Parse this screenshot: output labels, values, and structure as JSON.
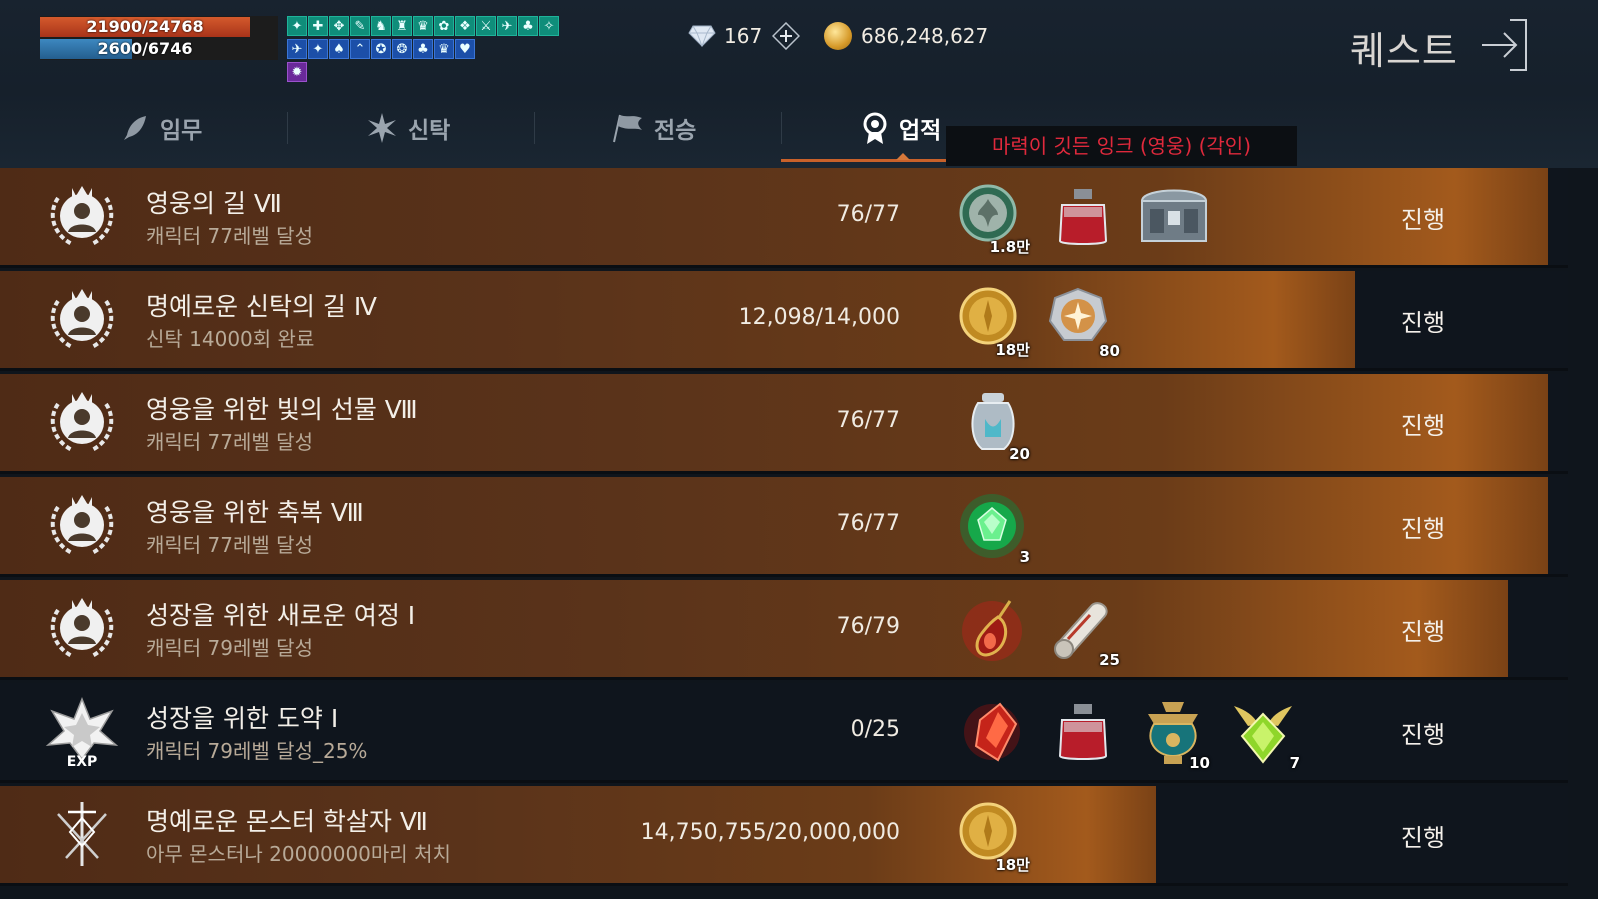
{
  "player": {
    "hp_text": "21900/24768",
    "hp_fraction": 0.884,
    "mp_text": "2600/6746",
    "mp_fraction": 0.385
  },
  "buffs": {
    "row1": [
      "✦",
      "✚",
      "✥",
      "✎",
      "♞",
      "♜",
      "♛",
      "✿",
      "❖",
      "⚔",
      "✈",
      "♣",
      "✧"
    ],
    "row2": [
      "✈",
      "✦",
      "♠",
      "⌃",
      "✪",
      "❂",
      "♣",
      "♛",
      "♥"
    ],
    "row3": [
      "✹"
    ]
  },
  "currency": {
    "gems": "167",
    "gold": "686,248,627"
  },
  "header": {
    "title": "퀘스트"
  },
  "tabs": [
    {
      "label": "임무",
      "icon": "feather-icon",
      "active": false
    },
    {
      "label": "신탁",
      "icon": "starburst-icon",
      "active": false
    },
    {
      "label": "전승",
      "icon": "flag-icon",
      "active": false
    },
    {
      "label": "업적",
      "icon": "medal-icon",
      "active": true
    }
  ],
  "tooltip": "마력이 깃든 잉크 (영웅) (각인)",
  "achievements": [
    {
      "title": "영웅의 길 Ⅶ",
      "desc": "캐릭터 77레벨 달성",
      "progress": "76/77",
      "fraction": 0.987,
      "emblem": "hero-crown-emblem",
      "rewards": [
        {
          "icon": "silver-fleur-coin-icon",
          "qty": "1.8만"
        },
        {
          "icon": "red-ink-bottle-icon",
          "qty": ""
        },
        {
          "icon": "steel-chest-icon",
          "qty": ""
        }
      ],
      "button": "진행"
    },
    {
      "title": "명예로운 신탁의 길 Ⅳ",
      "desc": "신탁 14000회 완료",
      "progress": "12,098/14,000",
      "fraction": 0.864,
      "emblem": "hero-crown-emblem",
      "rewards": [
        {
          "icon": "gold-coin-icon",
          "qty": "18만"
        },
        {
          "icon": "star-badge-icon",
          "qty": "80"
        }
      ],
      "button": "진행"
    },
    {
      "title": "영웅을 위한 빛의 선물 Ⅷ",
      "desc": "캐릭터 77레벨 달성",
      "progress": "76/77",
      "fraction": 0.987,
      "emblem": "hero-crown-emblem",
      "rewards": [
        {
          "icon": "silver-urn-icon",
          "qty": "20"
        }
      ],
      "button": "진행"
    },
    {
      "title": "영웅을 위한 축복 Ⅷ",
      "desc": "캐릭터 77레벨 달성",
      "progress": "76/77",
      "fraction": 0.987,
      "emblem": "hero-crown-emblem",
      "rewards": [
        {
          "icon": "green-gem-orb-icon",
          "qty": "3"
        }
      ],
      "button": "진행"
    },
    {
      "title": "성장을 위한 새로운 여정 Ⅰ",
      "desc": "캐릭터 79레벨 달성",
      "progress": "76/79",
      "fraction": 0.962,
      "emblem": "hero-crown-emblem",
      "rewards": [
        {
          "icon": "ruby-amulet-icon",
          "qty": ""
        },
        {
          "icon": "scroll-icon",
          "qty": "25"
        }
      ],
      "button": "진행"
    },
    {
      "title": "성장을 위한 도약 Ⅰ",
      "desc": "캐릭터 79레벨 달성_25%",
      "progress": "0/25",
      "fraction": 0,
      "emblem": "exp-star-emblem",
      "emblem_label": "EXP",
      "rewards": [
        {
          "icon": "red-crystal-icon",
          "qty": ""
        },
        {
          "icon": "red-ink-bottle-icon",
          "qty": ""
        },
        {
          "icon": "teal-vase-icon",
          "qty": "10"
        },
        {
          "icon": "winged-green-gem-icon",
          "qty": "7"
        }
      ],
      "button": "진행"
    },
    {
      "title": "명예로운 몬스터 학살자 Ⅶ",
      "desc": "아무 몬스터나 20000000마리 처치",
      "progress": "14,750,755/20,000,000",
      "fraction": 0.7375,
      "emblem": "swords-emblem",
      "rewards": [
        {
          "icon": "gold-coin-icon",
          "qty": "18만"
        }
      ],
      "button": "진행"
    }
  ],
  "colors": {
    "accent": "#c8612a",
    "tooltip_text": "#e0293c",
    "hp": "#c0441f",
    "mp": "#2f76ad"
  }
}
